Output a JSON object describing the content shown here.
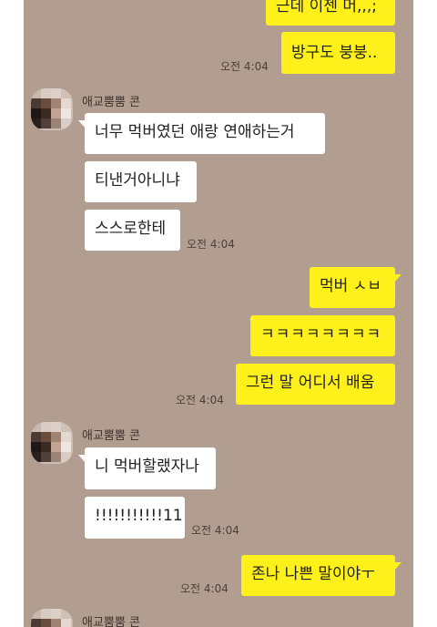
{
  "colors": {
    "chat_background": "#b29e91",
    "outgoing_bubble": "#fef01b",
    "incoming_bubble": "#ffffff"
  },
  "messages": {
    "m1": "근데 이젠 머,,,;",
    "m2": "방구도 붕붕..",
    "m2_time": "오전 4:04",
    "sender1": "애교뿜뿜 콘",
    "m3": "너무 먹버였던 애랑 연애하는거",
    "m4": "티낸거아니냐",
    "m5": "스스로한테",
    "m5_time": "오전 4:04",
    "m6": "먹버 ㅅㅂ",
    "m7": "ㅋㅋㅋㅋㅋㅋㅋㅋ",
    "m8": "그런 말 어디서 배움",
    "m8_time": "오전 4:04",
    "sender2": "애교뿜뿜 콘",
    "m9": "니 먹버할랬자나",
    "m10": "!!!!!!!!!!!11",
    "m10_time": "오전 4:04",
    "m11": "존나 나쁜 말이야ㅜ",
    "m11_time": "오전 4:04",
    "sender3": "애교뿜뿜 콘"
  }
}
